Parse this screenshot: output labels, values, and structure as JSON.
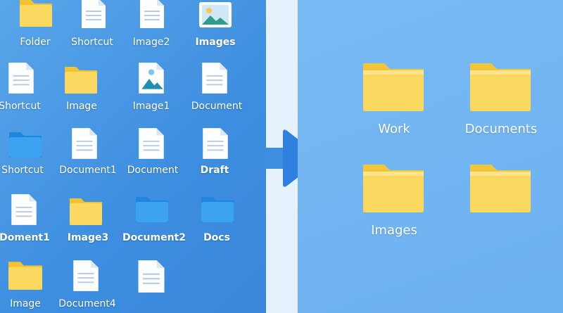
{
  "left_pane": {
    "items": [
      {
        "label": "Folder",
        "icon": "yellow-folder-icon"
      },
      {
        "label": "Shortcut",
        "icon": "document-icon"
      },
      {
        "label": "Image2",
        "icon": "document-icon"
      },
      {
        "label": "Images",
        "icon": "image-file-icon"
      },
      {
        "label": "Shortcut",
        "icon": "document-icon"
      },
      {
        "label": "Image",
        "icon": "yellow-folder-icon"
      },
      {
        "label": "Image1",
        "icon": "image-file-icon"
      },
      {
        "label": "Document",
        "icon": "document-icon"
      },
      {
        "label": "Shortcut",
        "icon": "blue-folder-icon"
      },
      {
        "label": "Document1",
        "icon": "document-icon"
      },
      {
        "label": "Document",
        "icon": "document-icon"
      },
      {
        "label": "Draft",
        "icon": "document-icon"
      },
      {
        "label": "Doment1",
        "icon": "document-icon"
      },
      {
        "label": "Image3",
        "icon": "yellow-folder-icon"
      },
      {
        "label": "Document2",
        "icon": "blue-folder-icon"
      },
      {
        "label": "Docs",
        "icon": "blue-folder-icon"
      },
      {
        "label": "Image",
        "icon": "yellow-folder-icon"
      },
      {
        "label": "Document4",
        "icon": "document-icon"
      },
      {
        "label": "",
        "icon": "document-icon"
      }
    ]
  },
  "right_pane": {
    "folders": [
      {
        "label": "Work",
        "icon": "yellow-folder-icon"
      },
      {
        "label": "Documents",
        "icon": "yellow-folder-icon"
      },
      {
        "label": "Images",
        "icon": "yellow-folder-icon"
      },
      {
        "label": "",
        "icon": "yellow-folder-icon"
      }
    ]
  },
  "colors": {
    "folder_yellow": "#f7d35a",
    "folder_blue": "#3a9ff0",
    "arrow_blue": "#2f80e0"
  }
}
